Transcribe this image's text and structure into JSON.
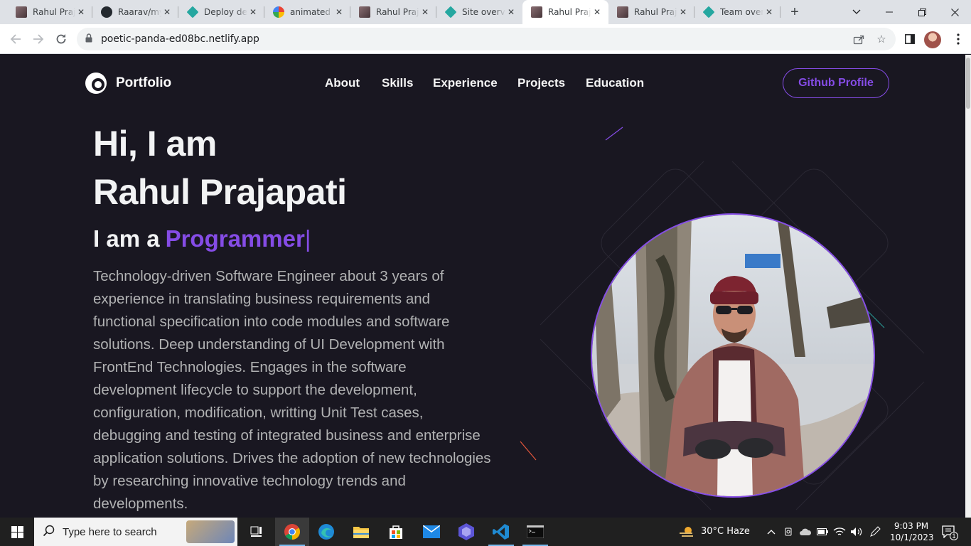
{
  "browser": {
    "tabs": [
      {
        "title": "Rahul Prajapati",
        "favicon": "avatar"
      },
      {
        "title": "Raarav/my-portfolio",
        "favicon": "github"
      },
      {
        "title": "Deploy details",
        "favicon": "netlify"
      },
      {
        "title": "animated text",
        "favicon": "google"
      },
      {
        "title": "Rahul Prajapati",
        "favicon": "avatar"
      },
      {
        "title": "Site overview",
        "favicon": "netlify"
      },
      {
        "title": "Rahul Prajapati",
        "favicon": "avatar"
      },
      {
        "title": "Rahul Prajapati",
        "favicon": "avatar"
      },
      {
        "title": "Team overview",
        "favicon": "netlify"
      }
    ],
    "active_tab": 6,
    "url": "poetic-panda-ed08bc.netlify.app"
  },
  "site": {
    "brand": "Portfolio",
    "nav": [
      "About",
      "Skills",
      "Experience",
      "Projects",
      "Education"
    ],
    "cta": "Github Profile",
    "greeting": "Hi, I am",
    "name": "Rahul Prajapati",
    "role_prefix": "I am a",
    "role_typed": "Programmer",
    "caret": "|",
    "bio": "Technology-driven Software Engineer about 3 years of experience in translating business requirements and functional specification into code modules and software solutions. Deep understanding of UI Development with FrontEnd Technologies. Engages in the software development lifecycle to support the development, configuration, modification, writting Unit Test cases, debugging and testing of integrated business and enterprise application solutions. Drives the adoption of new technologies by researching innovative technology trends and developments.",
    "accent_color": "#854ce6",
    "background_color": "#191721"
  },
  "taskbar": {
    "search_placeholder": "Type here to search",
    "weather": "30°C  Haze",
    "time": "9:03 PM",
    "date": "10/1/2023",
    "notification_count": "1"
  }
}
